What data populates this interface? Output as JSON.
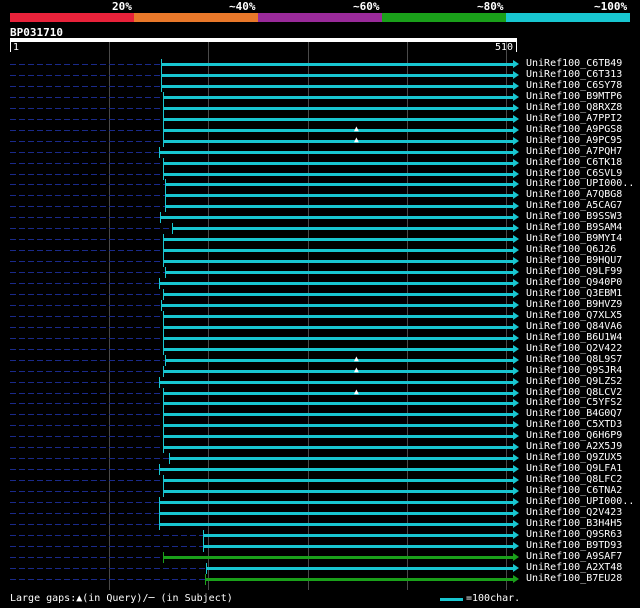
{
  "legend": {
    "segments": [
      {
        "label": "20%",
        "color": "#e8223a"
      },
      {
        "label": "~40%",
        "color": "#e8782a"
      },
      {
        "label": "~60%",
        "color": "#9a2a9a"
      },
      {
        "label": "~80%",
        "color": "#1aa01a"
      },
      {
        "label": "~100%",
        "color": "#18c6d0"
      }
    ]
  },
  "query": {
    "id": "BP031710",
    "start": "1",
    "end": "510"
  },
  "hits": [
    {
      "label": "UniRef100_C6TB49",
      "color": "#18c6d0",
      "start": 153,
      "gaps": []
    },
    {
      "label": "UniRef100_C6T313",
      "color": "#18c6d0",
      "start": 153,
      "gaps": []
    },
    {
      "label": "UniRef100_C6SY78",
      "color": "#18c6d0",
      "start": 153,
      "gaps": []
    },
    {
      "label": "UniRef100_B9MTP6",
      "color": "#18c6d0",
      "start": 155,
      "gaps": []
    },
    {
      "label": "UniRef100_Q8RXZ8",
      "color": "#18c6d0",
      "start": 155,
      "gaps": []
    },
    {
      "label": "UniRef100_A7PPI2",
      "color": "#18c6d0",
      "start": 155,
      "gaps": []
    },
    {
      "label": "UniRef100_A9PGS8",
      "color": "#18c6d0",
      "start": 155,
      "gaps": [
        350
      ]
    },
    {
      "label": "UniRef100_A9PC95",
      "color": "#18c6d0",
      "start": 155,
      "gaps": [
        350
      ]
    },
    {
      "label": "UniRef100_A7PQH7",
      "color": "#18c6d0",
      "start": 151,
      "gaps": []
    },
    {
      "label": "UniRef100_C6TK18",
      "color": "#18c6d0",
      "start": 155,
      "gaps": []
    },
    {
      "label": "UniRef100_C6SVL9",
      "color": "#18c6d0",
      "start": 155,
      "gaps": []
    },
    {
      "label": "UniRef100_UPI000..",
      "color": "#18c6d0",
      "start": 157,
      "gaps": []
    },
    {
      "label": "UniRef100_A7QBG8",
      "color": "#18c6d0",
      "start": 157,
      "gaps": []
    },
    {
      "label": "UniRef100_A5CAG7",
      "color": "#18c6d0",
      "start": 157,
      "gaps": []
    },
    {
      "label": "UniRef100_B9SSW3",
      "color": "#18c6d0",
      "start": 152,
      "gaps": []
    },
    {
      "label": "UniRef100_B9SAM4",
      "color": "#18c6d0",
      "start": 164,
      "gaps": []
    },
    {
      "label": "UniRef100_B9MYI4",
      "color": "#18c6d0",
      "start": 155,
      "gaps": []
    },
    {
      "label": "UniRef100_Q6J26",
      "color": "#18c6d0",
      "start": 155,
      "gaps": []
    },
    {
      "label": "UniRef100_B9HQU7",
      "color": "#18c6d0",
      "start": 155,
      "gaps": []
    },
    {
      "label": "UniRef100_Q9LF99",
      "color": "#18c6d0",
      "start": 157,
      "gaps": []
    },
    {
      "label": "UniRef100_Q940P0",
      "color": "#18c6d0",
      "start": 151,
      "gaps": []
    },
    {
      "label": "UniRef100_Q3EBM1",
      "color": "#18c6d0",
      "start": 155,
      "gaps": []
    },
    {
      "label": "UniRef100_B9HVZ9",
      "color": "#18c6d0",
      "start": 153,
      "gaps": []
    },
    {
      "label": "UniRef100_Q7XLX5",
      "color": "#18c6d0",
      "start": 155,
      "gaps": []
    },
    {
      "label": "UniRef100_Q84VA6",
      "color": "#18c6d0",
      "start": 155,
      "gaps": []
    },
    {
      "label": "UniRef100_B6U1W4",
      "color": "#18c6d0",
      "start": 155,
      "gaps": []
    },
    {
      "label": "UniRef100_Q2V422",
      "color": "#18c6d0",
      "start": 155,
      "gaps": []
    },
    {
      "label": "UniRef100_Q8L9S7",
      "color": "#18c6d0",
      "start": 157,
      "gaps": [
        350
      ]
    },
    {
      "label": "UniRef100_Q9SJR4",
      "color": "#18c6d0",
      "start": 155,
      "gaps": [
        350
      ]
    },
    {
      "label": "UniRef100_Q9LZS2",
      "color": "#18c6d0",
      "start": 151,
      "gaps": []
    },
    {
      "label": "UniRef100_Q8LCV2",
      "color": "#18c6d0",
      "start": 155,
      "gaps": [
        350
      ]
    },
    {
      "label": "UniRef100_C5YFS2",
      "color": "#18c6d0",
      "start": 155,
      "gaps": []
    },
    {
      "label": "UniRef100_B4G0Q7",
      "color": "#18c6d0",
      "start": 155,
      "gaps": []
    },
    {
      "label": "UniRef100_C5XTD3",
      "color": "#18c6d0",
      "start": 155,
      "gaps": []
    },
    {
      "label": "UniRef100_Q6H6P9",
      "color": "#18c6d0",
      "start": 155,
      "gaps": []
    },
    {
      "label": "UniRef100_A2X5J9",
      "color": "#18c6d0",
      "start": 155,
      "gaps": []
    },
    {
      "label": "UniRef100_Q9ZUX5",
      "color": "#18c6d0",
      "start": 161,
      "gaps": []
    },
    {
      "label": "UniRef100_Q9LFA1",
      "color": "#18c6d0",
      "start": 151,
      "gaps": []
    },
    {
      "label": "UniRef100_Q8LFC2",
      "color": "#18c6d0",
      "start": 155,
      "gaps": []
    },
    {
      "label": "UniRef100_C6TNA2",
      "color": "#18c6d0",
      "start": 155,
      "gaps": []
    },
    {
      "label": "UniRef100_UPI000..",
      "color": "#18c6d0",
      "start": 151,
      "gaps": []
    },
    {
      "label": "UniRef100_Q2V423",
      "color": "#18c6d0",
      "start": 151,
      "gaps": []
    },
    {
      "label": "UniRef100_B3H4H5",
      "color": "#18c6d0",
      "start": 151,
      "gaps": []
    },
    {
      "label": "UniRef100_Q9SR63",
      "color": "#18c6d0",
      "start": 195,
      "gaps": []
    },
    {
      "label": "UniRef100_B9TD93",
      "color": "#18c6d0",
      "start": 195,
      "gaps": []
    },
    {
      "label": "UniRef100_A9SAF7",
      "color": "#1aa01a",
      "start": 155,
      "gaps": []
    },
    {
      "label": "UniRef100_A2XT48",
      "color": "#18c6d0",
      "start": 198,
      "gaps": []
    },
    {
      "label": "UniRef100_B7EU28",
      "color": "#1aa01a",
      "start": 197,
      "gaps": []
    }
  ],
  "footer": {
    "large_gaps_text": "Large gaps:▲(in Query)/─ (in Subject)",
    "scale_text": "=100char."
  }
}
